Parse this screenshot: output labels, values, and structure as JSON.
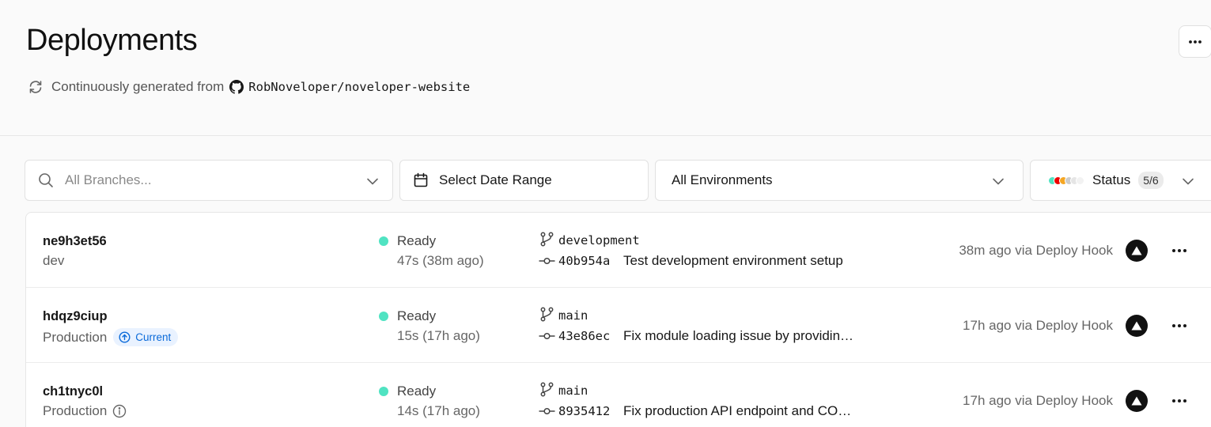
{
  "header": {
    "title": "Deployments",
    "subtitle_prefix": "Continuously generated from",
    "repo": "RobNoveloper/noveloper-website",
    "more_icon": "ellipsis-icon"
  },
  "filters": {
    "branches_placeholder": "All Branches...",
    "date_range_label": "Select Date Range",
    "environments_label": "All Environments",
    "status_label": "Status",
    "status_count": "5/6",
    "status_colors": [
      "#50e3c2",
      "#ee0000",
      "#f5a623",
      "#cccccc",
      "#e5e5e5",
      "#f2f2f2"
    ]
  },
  "deployments": [
    {
      "id": "ne9h3et56",
      "environment": "dev",
      "status": "Ready",
      "status_color": "#50e3c2",
      "duration": "47s (38m ago)",
      "branch": "development",
      "commit_hash": "40b954a",
      "commit_message": "Test development environment setup",
      "ago": "38m ago via Deploy Hook"
    },
    {
      "id": "hdqz9ciup",
      "environment": "Production",
      "current_badge": "Current",
      "status": "Ready",
      "status_color": "#50e3c2",
      "duration": "15s (17h ago)",
      "branch": "main",
      "commit_hash": "43e86ec",
      "commit_message": "Fix module loading issue by providing proper configuration",
      "ago": "17h ago via Deploy Hook"
    },
    {
      "id": "ch1tnyc0l",
      "environment": "Production",
      "status": "Ready",
      "status_color": "#50e3c2",
      "duration": "14s (17h ago)",
      "branch": "main",
      "commit_hash": "8935412",
      "commit_message": "Fix production API endpoint and CORS configuration",
      "ago": "17h ago via Deploy Hook"
    }
  ]
}
